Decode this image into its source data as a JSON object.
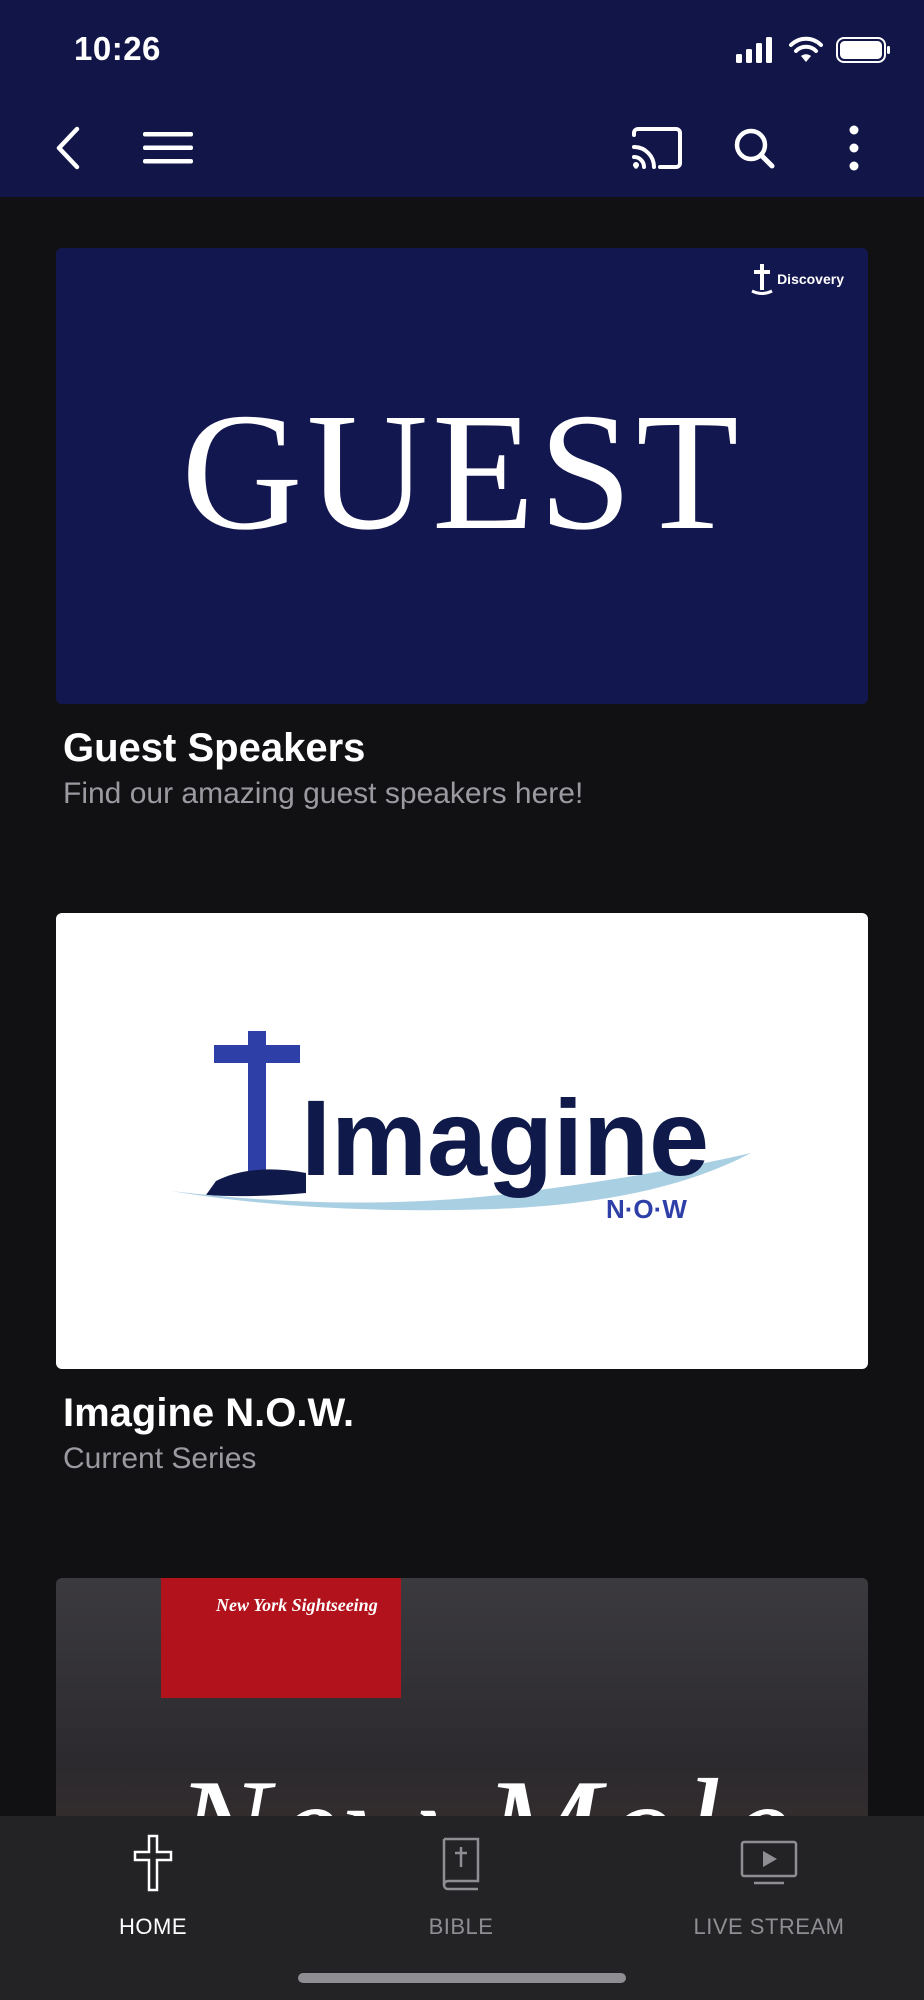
{
  "status_bar": {
    "time": "10:26"
  },
  "nav": {
    "back_icon": "chevron-left-icon",
    "menu_icon": "hamburger-icon",
    "cast_icon": "cast-icon",
    "search_icon": "search-icon",
    "more_icon": "more-vertical-icon"
  },
  "cards": [
    {
      "image_text": "GUEST",
      "image_logo": "Discovery",
      "title": "Guest Speakers",
      "subtitle": "Find our amazing guest speakers here!"
    },
    {
      "image_text": "Imagine",
      "image_subtext": "N·O·W",
      "title": "Imagine N.O.W.",
      "subtitle": "Current Series"
    },
    {
      "image_banner": "New York Sightseeing",
      "image_text": "New Mole"
    }
  ],
  "tabbar": {
    "items": [
      {
        "label": "HOME",
        "icon": "cross-icon",
        "active": true
      },
      {
        "label": "BIBLE",
        "icon": "bible-icon",
        "active": false
      },
      {
        "label": "LIVE STREAM",
        "icon": "play-icon",
        "active": false
      }
    ]
  },
  "colors": {
    "navy": "#121548",
    "background": "#111114",
    "tabbar": "#232326",
    "imagine_blue": "#2f3fa8",
    "imagine_navy": "#0f1a4a"
  }
}
